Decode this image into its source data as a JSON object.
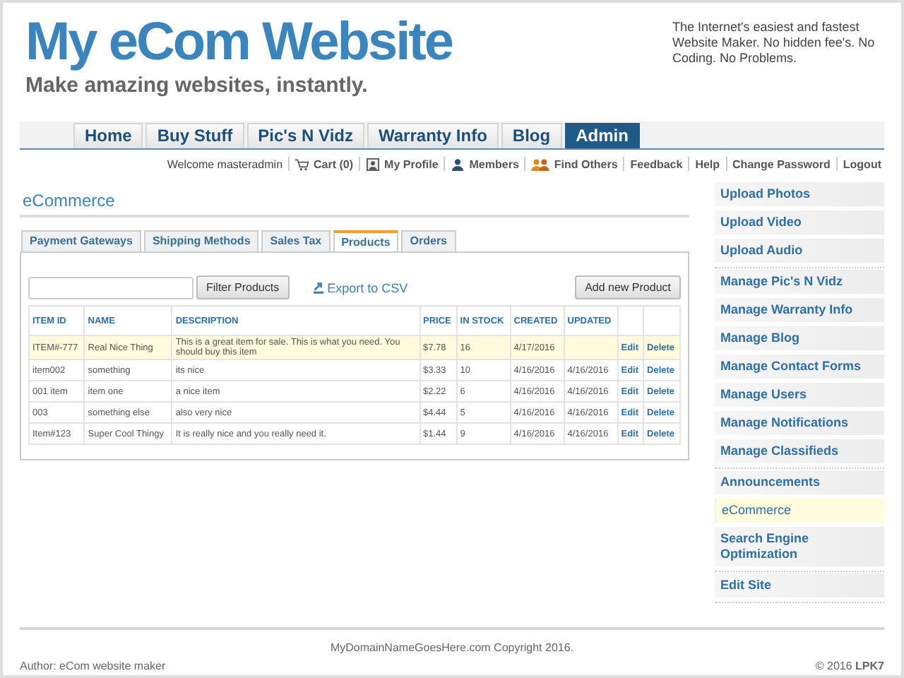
{
  "header": {
    "title": "My eCom Website",
    "tagline": "Make amazing websites, instantly.",
    "blurb": "The Internet's easiest and fastest Website Maker. No hidden fee's. No Coding. No Problems."
  },
  "nav": [
    {
      "label": "Home",
      "selected": false
    },
    {
      "label": "Buy Stuff",
      "selected": false
    },
    {
      "label": "Pic's N Vidz",
      "selected": false
    },
    {
      "label": "Warranty Info",
      "selected": false
    },
    {
      "label": "Blog",
      "selected": false
    },
    {
      "label": "Admin",
      "selected": true
    }
  ],
  "user_bar": {
    "welcome": "Welcome masteradmin",
    "links": [
      {
        "label": "Cart (0)",
        "kind": "cart"
      },
      {
        "label": "My Profile",
        "kind": "profile"
      },
      {
        "label": "Members",
        "kind": "members"
      },
      {
        "label": "Find Others",
        "kind": "find"
      },
      {
        "label": "Feedback",
        "kind": "none"
      },
      {
        "label": "Help",
        "kind": "none"
      },
      {
        "label": "Change Password",
        "kind": "none"
      },
      {
        "label": "Logout",
        "kind": "none"
      }
    ]
  },
  "section_title": "eCommerce",
  "tabs": [
    {
      "label": "Payment Gateways",
      "selected": false
    },
    {
      "label": "Shipping Methods",
      "selected": false
    },
    {
      "label": "Sales Tax",
      "selected": false
    },
    {
      "label": "Products",
      "selected": true
    },
    {
      "label": "Orders",
      "selected": false
    }
  ],
  "toolbar": {
    "filter_button": "Filter Products",
    "export_link": "Export to CSV",
    "add_button": "Add new Product"
  },
  "table": {
    "columns": [
      "ITEM ID",
      "NAME",
      "DESCRIPTION",
      "PRICE",
      "IN STOCK",
      "CREATED",
      "UPDATED"
    ],
    "rows": [
      {
        "selected": true,
        "cells": [
          "ITEM#-777",
          "Real Nice Thing",
          "This is a great item for sale. This is what you need. You should buy this item",
          "$7.78",
          "16",
          "4/17/2016",
          ""
        ],
        "edit": "Edit",
        "delete": "Delete"
      },
      {
        "selected": false,
        "cells": [
          "item002",
          "something",
          "its nice",
          "$3.33",
          "10",
          "4/16/2016",
          "4/16/2016"
        ],
        "edit": "Edit",
        "delete": "Delete"
      },
      {
        "selected": false,
        "cells": [
          "001 item",
          "item one",
          "a nice item",
          "$2.22",
          "6",
          "4/16/2016",
          "4/16/2016"
        ],
        "edit": "Edit",
        "delete": "Delete"
      },
      {
        "selected": false,
        "cells": [
          "003",
          "something else",
          "also very nice",
          "$4.44",
          "5",
          "4/16/2016",
          "4/16/2016"
        ],
        "edit": "Edit",
        "delete": "Delete"
      },
      {
        "selected": false,
        "cells": [
          "Item#123",
          "Super Cool Thingy",
          "It is really nice and you really need it.",
          "$1.44",
          "9",
          "4/16/2016",
          "4/16/2016"
        ],
        "edit": "Edit",
        "delete": "Delete"
      }
    ]
  },
  "sidebar": {
    "groups": [
      [
        {
          "label": "Upload Photos",
          "selected": false
        },
        {
          "label": "Upload Video",
          "selected": false
        },
        {
          "label": "Upload Audio",
          "selected": false
        }
      ],
      [
        {
          "label": "Manage Pic's N Vidz",
          "selected": false
        },
        {
          "label": "Manage Warranty Info",
          "selected": false
        },
        {
          "label": "Manage Blog",
          "selected": false
        },
        {
          "label": "Manage Contact Forms",
          "selected": false
        },
        {
          "label": "Manage Users",
          "selected": false
        },
        {
          "label": "Manage Notifications",
          "selected": false
        },
        {
          "label": "Manage Classifieds",
          "selected": false
        }
      ],
      [
        {
          "label": "Announcements",
          "selected": false
        },
        {
          "label": "eCommerce",
          "selected": true
        },
        {
          "label": "Search Engine Optimization",
          "selected": false
        }
      ],
      [
        {
          "label": "Edit Site",
          "selected": false
        }
      ]
    ]
  },
  "footer": {
    "copyright": "MyDomainNameGoesHere.com Copyright 2016.",
    "author": "Author: eCom website maker",
    "credit": "© 2016 **LPK7**"
  }
}
